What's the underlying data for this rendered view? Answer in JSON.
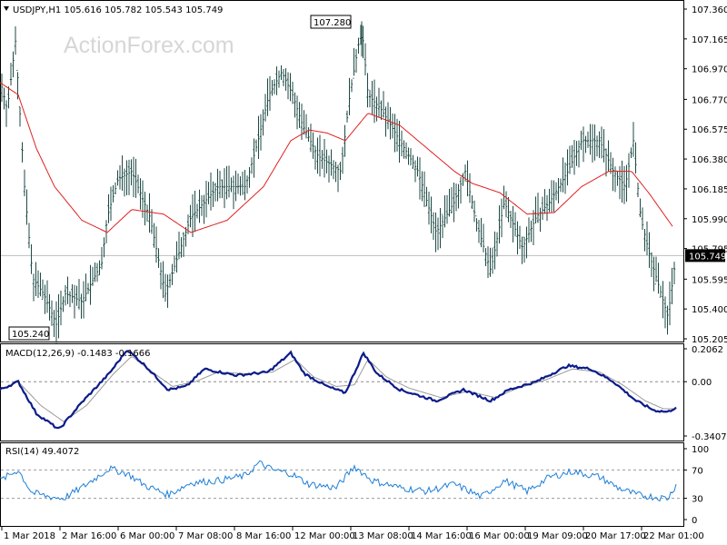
{
  "header": {
    "symbol_info": "USDJPY,H1  105.616 105.782 105.543 105.749",
    "watermark": "ActionForex.com"
  },
  "chart_data": [
    {
      "type": "candlestick",
      "title": "USDJPY,H1",
      "ohlc_last": {
        "open": 105.616,
        "high": 105.782,
        "low": 105.543,
        "close": 105.749
      },
      "ylim": [
        105.205,
        107.36
      ],
      "y_ticks": [
        107.36,
        107.165,
        106.97,
        106.77,
        106.575,
        106.38,
        106.185,
        105.99,
        105.795,
        105.595,
        105.4,
        105.205
      ],
      "x_tick_labels": [
        "1 Mar 2018",
        "2 Mar 16:00",
        "6 Mar 00:00",
        "7 Mar 08:00",
        "8 Mar 16:00",
        "12 Mar 00:00",
        "13 Mar 08:00",
        "14 Mar 16:00",
        "16 Mar 00:00",
        "19 Mar 09:00",
        "20 Mar 17:00",
        "22 Mar 01:00"
      ],
      "current_price": 105.749,
      "annotations": {
        "high_label": "107.280",
        "high_value": 107.28,
        "low_label": "105.240",
        "low_value": 105.24
      },
      "price_keypoints": [
        [
          0,
          106.9
        ],
        [
          8,
          106.7
        ],
        [
          17,
          107.15
        ],
        [
          27,
          106.2
        ],
        [
          36,
          105.6
        ],
        [
          48,
          105.5
        ],
        [
          62,
          105.3
        ],
        [
          72,
          105.5
        ],
        [
          90,
          105.45
        ],
        [
          112,
          105.7
        ],
        [
          118,
          106.0
        ],
        [
          130,
          106.25
        ],
        [
          145,
          106.3
        ],
        [
          165,
          106.0
        ],
        [
          182,
          105.5
        ],
        [
          196,
          105.75
        ],
        [
          210,
          106.0
        ],
        [
          240,
          106.2
        ],
        [
          270,
          106.2
        ],
        [
          284,
          106.5
        ],
        [
          296,
          106.8
        ],
        [
          310,
          106.95
        ],
        [
          322,
          106.8
        ],
        [
          333,
          106.6
        ],
        [
          350,
          106.4
        ],
        [
          375,
          106.3
        ],
        [
          385,
          106.8
        ],
        [
          398,
          107.25
        ],
        [
          405,
          106.8
        ],
        [
          420,
          106.7
        ],
        [
          440,
          106.5
        ],
        [
          460,
          106.3
        ],
        [
          480,
          105.9
        ],
        [
          500,
          106.1
        ],
        [
          512,
          106.3
        ],
        [
          525,
          105.95
        ],
        [
          540,
          105.65
        ],
        [
          555,
          106.1
        ],
        [
          575,
          105.8
        ],
        [
          590,
          106.0
        ],
        [
          605,
          106.1
        ],
        [
          625,
          106.3
        ],
        [
          640,
          106.5
        ],
        [
          660,
          106.5
        ],
        [
          675,
          106.3
        ],
        [
          688,
          106.2
        ],
        [
          697,
          106.5
        ],
        [
          705,
          106.0
        ],
        [
          715,
          105.75
        ],
        [
          725,
          105.55
        ],
        [
          735,
          105.35
        ],
        [
          744,
          105.75
        ]
      ],
      "ma_keypoints": [
        [
          0,
          106.88
        ],
        [
          20,
          106.8
        ],
        [
          40,
          106.45
        ],
        [
          60,
          106.2
        ],
        [
          90,
          105.98
        ],
        [
          118,
          105.9
        ],
        [
          145,
          106.05
        ],
        [
          180,
          106.02
        ],
        [
          210,
          105.9
        ],
        [
          250,
          105.98
        ],
        [
          290,
          106.2
        ],
        [
          320,
          106.5
        ],
        [
          340,
          106.57
        ],
        [
          360,
          106.55
        ],
        [
          380,
          106.5
        ],
        [
          405,
          106.68
        ],
        [
          440,
          106.6
        ],
        [
          470,
          106.45
        ],
        [
          500,
          106.3
        ],
        [
          520,
          106.22
        ],
        [
          550,
          106.16
        ],
        [
          580,
          106.02
        ],
        [
          610,
          106.03
        ],
        [
          640,
          106.2
        ],
        [
          670,
          106.3
        ],
        [
          695,
          106.3
        ],
        [
          715,
          106.15
        ],
        [
          740,
          105.94
        ]
      ]
    },
    {
      "type": "line",
      "title": "MACD(12,26,9) -0.1483 -0.1666",
      "ylim": [
        -0.3407,
        0.2062
      ],
      "y_ticks": [
        0.2062,
        0.0,
        -0.3407
      ],
      "y_tick_labels": [
        "0.2062",
        "0.00",
        "-0.3407"
      ],
      "zero_line": 0,
      "macd_keypoints": [
        [
          0,
          -0.05
        ],
        [
          20,
          0.0
        ],
        [
          40,
          -0.2
        ],
        [
          65,
          -0.3
        ],
        [
          90,
          -0.13
        ],
        [
          120,
          0.05
        ],
        [
          140,
          0.2
        ],
        [
          160,
          0.1
        ],
        [
          185,
          -0.05
        ],
        [
          205,
          -0.03
        ],
        [
          225,
          0.08
        ],
        [
          260,
          0.04
        ],
        [
          295,
          0.06
        ],
        [
          320,
          0.18
        ],
        [
          335,
          0.05
        ],
        [
          360,
          -0.03
        ],
        [
          380,
          -0.07
        ],
        [
          400,
          0.18
        ],
        [
          415,
          0.05
        ],
        [
          440,
          -0.05
        ],
        [
          480,
          -0.12
        ],
        [
          510,
          -0.05
        ],
        [
          540,
          -0.12
        ],
        [
          560,
          -0.05
        ],
        [
          590,
          0.0
        ],
        [
          625,
          0.1
        ],
        [
          650,
          0.08
        ],
        [
          675,
          0.0
        ],
        [
          700,
          -0.12
        ],
        [
          720,
          -0.18
        ],
        [
          735,
          -0.19
        ],
        [
          744,
          -0.16
        ]
      ],
      "signal_keypoints": [
        [
          0,
          -0.05
        ],
        [
          20,
          0.0
        ],
        [
          45,
          -0.15
        ],
        [
          70,
          -0.25
        ],
        [
          95,
          -0.15
        ],
        [
          125,
          0.05
        ],
        [
          145,
          0.16
        ],
        [
          170,
          0.05
        ],
        [
          190,
          -0.03
        ],
        [
          215,
          0.0
        ],
        [
          240,
          0.06
        ],
        [
          270,
          0.05
        ],
        [
          300,
          0.06
        ],
        [
          325,
          0.14
        ],
        [
          345,
          0.03
        ],
        [
          370,
          -0.03
        ],
        [
          390,
          -0.02
        ],
        [
          405,
          0.14
        ],
        [
          425,
          0.03
        ],
        [
          450,
          -0.04
        ],
        [
          485,
          -0.1
        ],
        [
          515,
          -0.06
        ],
        [
          545,
          -0.1
        ],
        [
          570,
          -0.04
        ],
        [
          600,
          0.01
        ],
        [
          630,
          0.08
        ],
        [
          660,
          0.06
        ],
        [
          685,
          -0.02
        ],
        [
          710,
          -0.12
        ],
        [
          730,
          -0.17
        ],
        [
          744,
          -0.17
        ]
      ]
    },
    {
      "type": "line",
      "title": "RSI(14) 49.4072",
      "ylim": [
        0,
        100
      ],
      "y_ticks": [
        100,
        70,
        30,
        0
      ],
      "levels": [
        70,
        30
      ],
      "rsi_keypoints": [
        [
          0,
          55
        ],
        [
          20,
          70
        ],
        [
          35,
          38
        ],
        [
          55,
          32
        ],
        [
          70,
          30
        ],
        [
          90,
          45
        ],
        [
          120,
          72
        ],
        [
          140,
          65
        ],
        [
          160,
          48
        ],
        [
          185,
          35
        ],
        [
          210,
          52
        ],
        [
          240,
          55
        ],
        [
          270,
          62
        ],
        [
          285,
          80
        ],
        [
          300,
          70
        ],
        [
          320,
          65
        ],
        [
          340,
          50
        ],
        [
          370,
          45
        ],
        [
          390,
          75
        ],
        [
          410,
          55
        ],
        [
          440,
          45
        ],
        [
          470,
          40
        ],
        [
          500,
          50
        ],
        [
          530,
          32
        ],
        [
          555,
          55
        ],
        [
          580,
          40
        ],
        [
          605,
          60
        ],
        [
          630,
          68
        ],
        [
          660,
          60
        ],
        [
          680,
          45
        ],
        [
          700,
          35
        ],
        [
          720,
          32
        ],
        [
          735,
          30
        ],
        [
          744,
          49.4
        ]
      ]
    }
  ],
  "colors": {
    "candle": "#1d4a44",
    "ma": "#e02020",
    "macd": "#0b1b8a",
    "signal": "#9a9a9a",
    "rsi": "#1e7fd6",
    "grid": "#c8c8c8"
  }
}
